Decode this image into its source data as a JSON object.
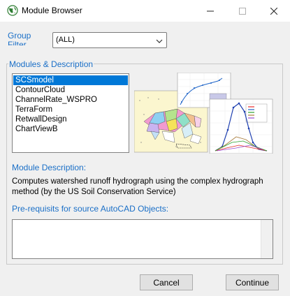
{
  "window": {
    "title": "Module Browser",
    "minimize_glyph": "—",
    "close_glyph": "✕"
  },
  "group_filter": {
    "label": "Group Filter",
    "selected": "(ALL)"
  },
  "modules_section": {
    "title": "Modules & Description",
    "items": [
      "SCSmodel",
      "ContourCloud",
      "ChannelRate_WSPRO",
      "TerraForm",
      "RetwallDesign",
      "ChartViewB"
    ],
    "selected_index": 0
  },
  "description": {
    "title": "Module Description:",
    "text": "Computes watershed runoff hydrograph using the complex hydrograph method (by the US Soil Conservation Service)"
  },
  "prerequisites": {
    "title": "Pre-requisits for source AutoCAD Objects:",
    "value": ""
  },
  "buttons": {
    "cancel": "Cancel",
    "continue": "Continue"
  },
  "colors": {
    "accent_label": "#1a6fc7",
    "selection": "#0078d7"
  }
}
